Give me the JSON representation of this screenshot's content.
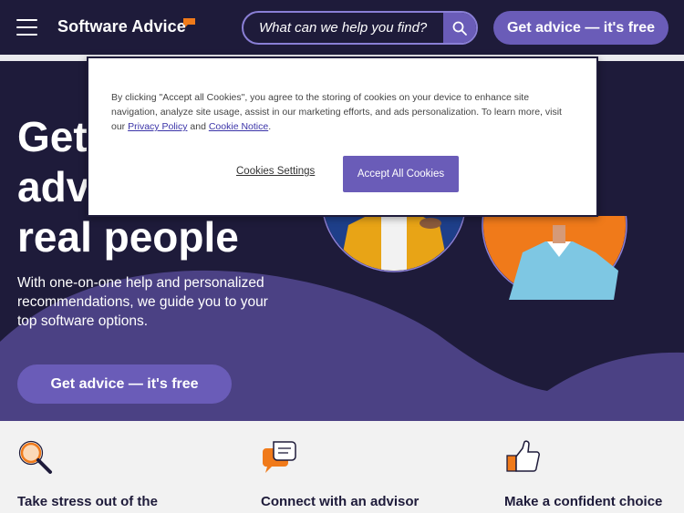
{
  "header": {
    "logo_text": "Software Advice",
    "search_placeholder": "What can we help you find?",
    "cta_label": "Get advice — it's free"
  },
  "hero": {
    "title_lines": [
      "Get",
      "advi",
      "real people"
    ],
    "subtitle": "With one-on-one help and personalized recommendations, we guide you to your top software options.",
    "cta_label": "Get advice — it's free"
  },
  "features": [
    {
      "title": "Take stress out of the",
      "icon": "magnifier-icon"
    },
    {
      "title": "Connect with an advisor",
      "icon": "chat-bubbles-icon"
    },
    {
      "title": "Make a confident choice",
      "icon": "thumbs-up-icon"
    }
  ],
  "cookie_banner": {
    "text_before": "By clicking \"Accept all Cookies\", you agree to the storing of cookies on your device to enhance site navigation, analyze site usage, assist in our marketing efforts, and ads personalization. To learn more, visit our",
    "privacy_link": "Privacy Policy",
    "and_text": "and",
    "cookie_link": "Cookie Notice",
    "period": ".",
    "settings_label": "Cookies Settings",
    "accept_label": "Accept All Cookies"
  },
  "colors": {
    "navy": "#1e1b3a",
    "purple": "#6a5cb8",
    "wave": "#4b4184",
    "orange": "#f07a1a"
  }
}
